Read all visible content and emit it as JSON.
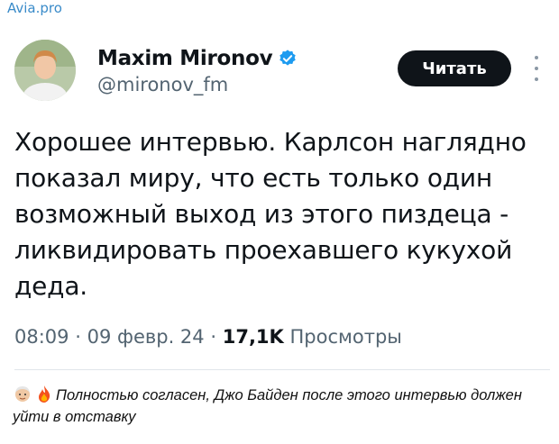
{
  "source": {
    "label": "Avia.pro"
  },
  "tweet": {
    "author_name": "Maxim Mironov",
    "handle": "@mironov_fm",
    "follow_label": "Читать",
    "text": "Хорошее интервью. Карлсон наглядно показал миру, что есть только один возможный выход из этого пиздеца - ликвидировать проехавшего кукухой деда.",
    "time": "08:09",
    "sep1": "·",
    "date": "09 февр. 24",
    "sep2": "·",
    "views_count": "17,1K",
    "views_label": "Просмотры",
    "verified_color": "#1d9bf0"
  },
  "caption": {
    "emoji1": "old-man-face-icon",
    "emoji2": "fire-icon",
    "text": "Полностью согласен, Джо Байден после этого интервью должен уйти в отставку"
  }
}
